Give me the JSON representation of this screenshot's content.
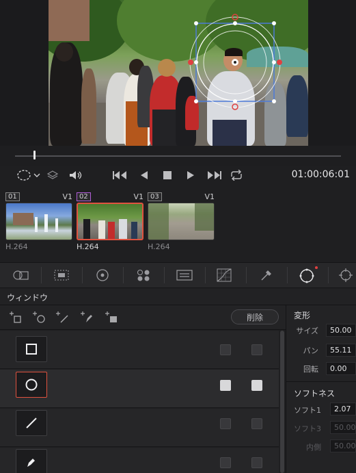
{
  "viewer": {
    "description_icon": "window-overlay"
  },
  "transport": {
    "timecode": "01:00:06:01"
  },
  "clips": [
    {
      "num": "01",
      "track": "V1",
      "codec": "H.264"
    },
    {
      "num": "02",
      "track": "V1",
      "codec": "H.264"
    },
    {
      "num": "03",
      "track": "V1",
      "codec": "H.264"
    }
  ],
  "panel": {
    "title": "ウィンドウ",
    "delete_label": "削除"
  },
  "transform": {
    "title": "変形",
    "size_label": "サイズ",
    "size_value": "50.00",
    "pan_label": "パン",
    "pan_value": "55.11",
    "rotate_label": "回転",
    "rotate_value": "0.00"
  },
  "softness": {
    "title": "ソフトネス",
    "soft1_label": "ソフト1",
    "soft1_value": "2.07",
    "soft3_label": "ソフト3",
    "soft3_value": "50.00",
    "inner_label": "内側",
    "inner_value": "50.00"
  },
  "colors": {
    "accent": "#e0523f",
    "selected_clip_badge": "#b15ed8",
    "keyframe_dot": "#e04040"
  }
}
